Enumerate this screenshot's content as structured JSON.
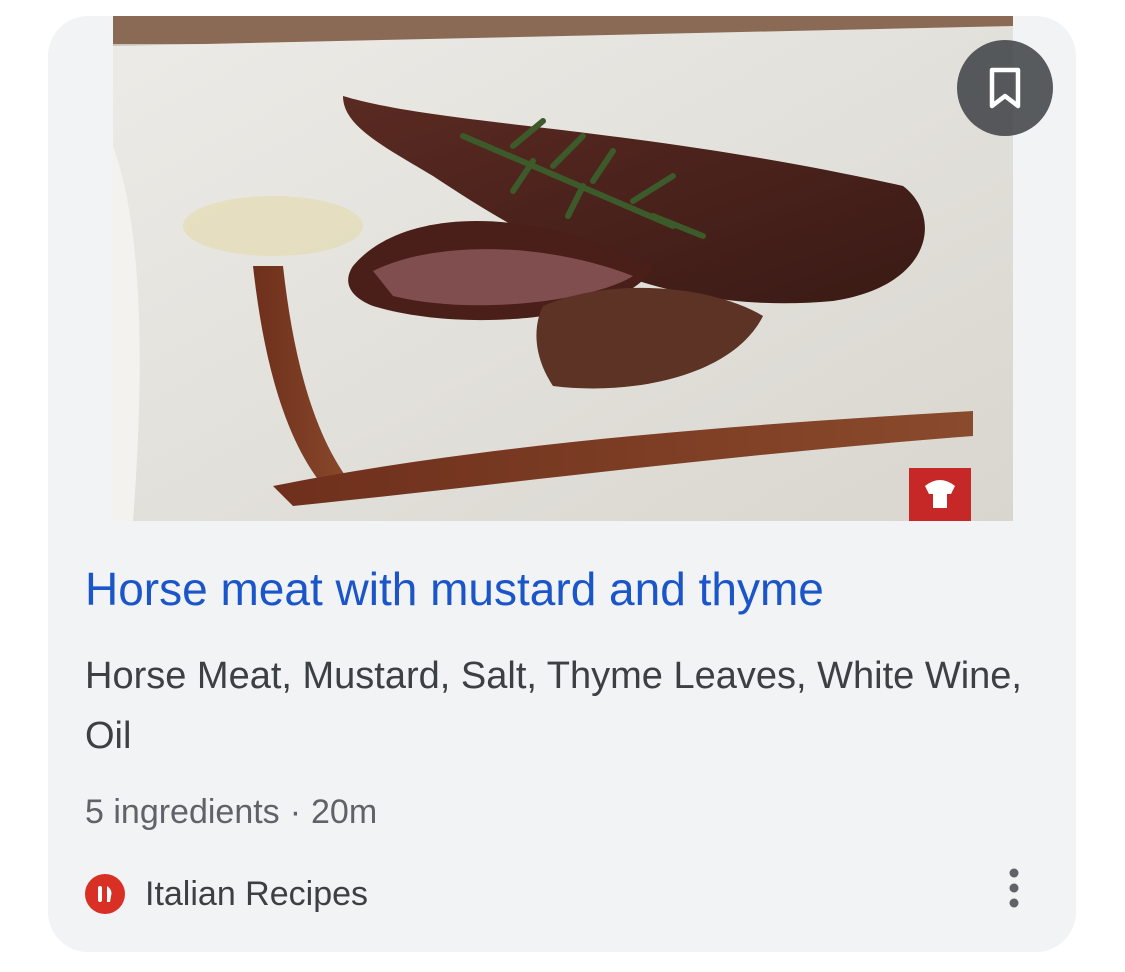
{
  "card": {
    "image_alt": "Horse meat with mustard and thyme",
    "save_icon": "bookmark-icon",
    "title": "Horse meat with mustard and thyme",
    "ingredients": "Horse Meat, Mustard, Salt, Thyme Leaves, White Wine, Oil",
    "meta": {
      "ingredient_count": "5 ingredients",
      "separator": "·",
      "time": "20m"
    },
    "source": {
      "name": "Italian Recipes",
      "logo_icon": "fork-knife-icon",
      "logo_color": "#d93025"
    },
    "more_icon": "more-vert-icon",
    "colors": {
      "title": "#1a55c9",
      "card_background": "#f1f3f4"
    }
  }
}
